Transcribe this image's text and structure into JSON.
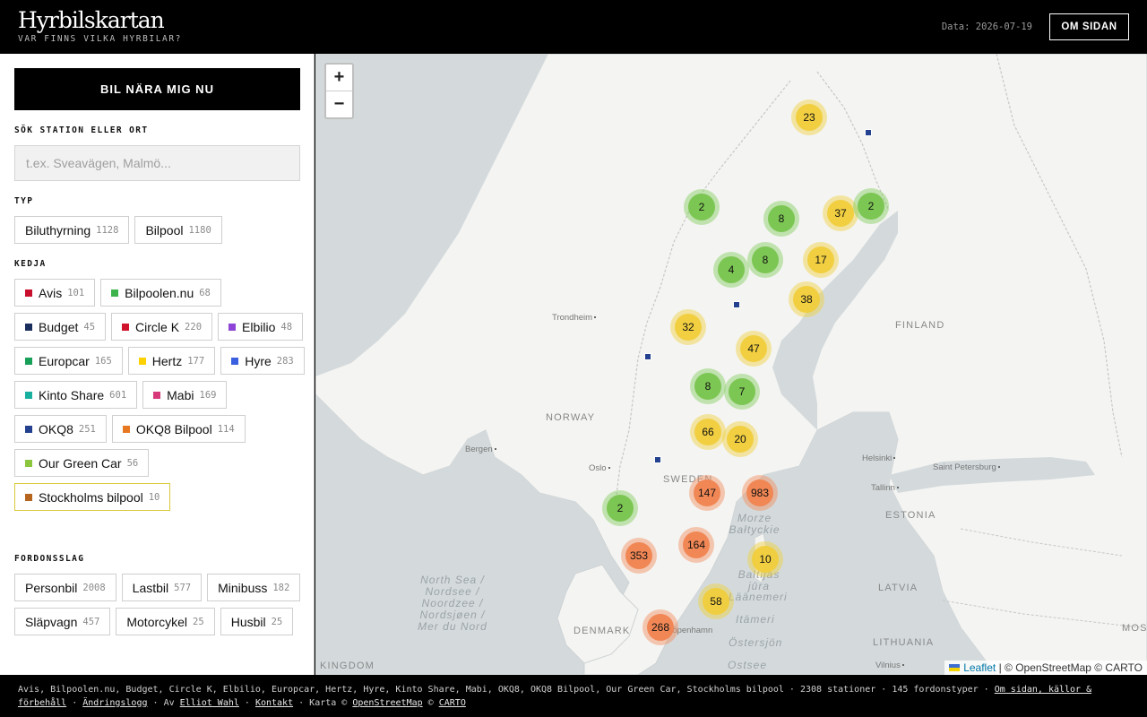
{
  "header": {
    "logo": "Hyrbilskartan",
    "tagline": "VAR FINNS VILKA HYRBILAR?",
    "data_date": "Data: 2026-07-19",
    "about_button": "OM SIDAN"
  },
  "sidebar": {
    "near_button": "BIL NÄRA MIG NU",
    "search_label": "SÖK STATION ELLER ORT",
    "search_placeholder": "t.ex. Sveavägen, Malmö...",
    "type_label": "TYP",
    "type_chips": [
      {
        "name": "Biluthyrning",
        "count": "1128"
      },
      {
        "name": "Bilpool",
        "count": "1180"
      }
    ],
    "chain_label": "KEDJA",
    "chain_chips": [
      {
        "name": "Avis",
        "count": "101",
        "color": "#c8102e"
      },
      {
        "name": "Bilpoolen.nu",
        "count": "68",
        "color": "#3cb44b"
      },
      {
        "name": "Budget",
        "count": "45",
        "color": "#1b2f5e"
      },
      {
        "name": "Circle K",
        "count": "220",
        "color": "#d0142c"
      },
      {
        "name": "Elbilio",
        "count": "48",
        "color": "#8e44d6"
      },
      {
        "name": "Europcar",
        "count": "165",
        "color": "#18a058"
      },
      {
        "name": "Hertz",
        "count": "177",
        "color": "#ffd100"
      },
      {
        "name": "Hyre",
        "count": "283",
        "color": "#3a5fe0"
      },
      {
        "name": "Kinto Share",
        "count": "601",
        "color": "#1ab0a0"
      },
      {
        "name": "Mabi",
        "count": "169",
        "color": "#d63a7a"
      },
      {
        "name": "OKQ8",
        "count": "251",
        "color": "#23418f"
      },
      {
        "name": "OKQ8 Bilpool",
        "count": "114",
        "color": "#e87722"
      },
      {
        "name": "Our Green Car",
        "count": "56",
        "color": "#8cc63f"
      },
      {
        "name": "Stockholms bilpool",
        "count": "10",
        "color": "#b5651d",
        "active": true
      }
    ],
    "vehicle_label": "FORDONSSLAG",
    "vehicle_chips": [
      {
        "name": "Personbil",
        "count": "2008"
      },
      {
        "name": "Lastbil",
        "count": "577"
      },
      {
        "name": "Minibuss",
        "count": "182"
      },
      {
        "name": "Släpvagn",
        "count": "457"
      },
      {
        "name": "Motorcykel",
        "count": "25"
      },
      {
        "name": "Husbil",
        "count": "25"
      }
    ]
  },
  "map": {
    "zoom_in": "+",
    "zoom_out": "−",
    "places": [
      "Trondheim",
      "Bergen",
      "Oslo",
      "Helsinki",
      "Saint Petersburg",
      "Tallinn",
      "Vilnius",
      "Köpenhamn"
    ],
    "countries": [
      "FINLAND",
      "NORWAY",
      "SWEDEN",
      "ESTONIA",
      "LATVIA",
      "DENMARK",
      "LITHUANIA",
      "KINGDOM",
      "MOSCO"
    ],
    "seas": [
      "North Sea / Nordsee / Noordzee / Nordsjøen / Mer du Nord",
      "Morze Bałtyckie",
      "Baltijas jūra",
      "Läänemeri",
      "Itämeri",
      "Östersjön",
      "Ostsee"
    ],
    "clusters": [
      {
        "label": "23",
        "tier": "medium"
      },
      {
        "label": "2",
        "tier": "small"
      },
      {
        "label": "8",
        "tier": "small"
      },
      {
        "label": "37",
        "tier": "medium"
      },
      {
        "label": "2",
        "tier": "small"
      },
      {
        "label": "4",
        "tier": "small"
      },
      {
        "label": "8",
        "tier": "small"
      },
      {
        "label": "17",
        "tier": "medium"
      },
      {
        "label": "38",
        "tier": "medium"
      },
      {
        "label": "32",
        "tier": "medium"
      },
      {
        "label": "47",
        "tier": "medium"
      },
      {
        "label": "8",
        "tier": "small"
      },
      {
        "label": "7",
        "tier": "small"
      },
      {
        "label": "66",
        "tier": "medium"
      },
      {
        "label": "20",
        "tier": "medium"
      },
      {
        "label": "147",
        "tier": "large"
      },
      {
        "label": "983",
        "tier": "large"
      },
      {
        "label": "2",
        "tier": "small"
      },
      {
        "label": "164",
        "tier": "large"
      },
      {
        "label": "353",
        "tier": "large"
      },
      {
        "label": "10",
        "tier": "medium"
      },
      {
        "label": "58",
        "tier": "medium"
      },
      {
        "label": "268",
        "tier": "large"
      }
    ],
    "attribution": {
      "leaflet": "Leaflet",
      "rest": "| © OpenStreetMap © CARTO"
    }
  },
  "footer": {
    "chains_text": "Avis, Bilpoolen.nu, Budget, Circle K, Elbilio, Europcar, Hertz, Hyre, Kinto Share, Mabi, OKQ8, OKQ8 Bilpool, Our Green Car, Stockholms bilpool · 2308 stationer · 145 fordonstyper ·",
    "about_link": "Om sidan, källor & förbehåll",
    "changelog_link": "Ändringslogg",
    "by_text": "· Av",
    "author_link": "Elliot Wahl",
    "contact_link": "Kontakt",
    "map_text": "· Karta ©",
    "osm_link": "OpenStreetMap",
    "copy_text": "©",
    "carto_link": "CARTO"
  }
}
